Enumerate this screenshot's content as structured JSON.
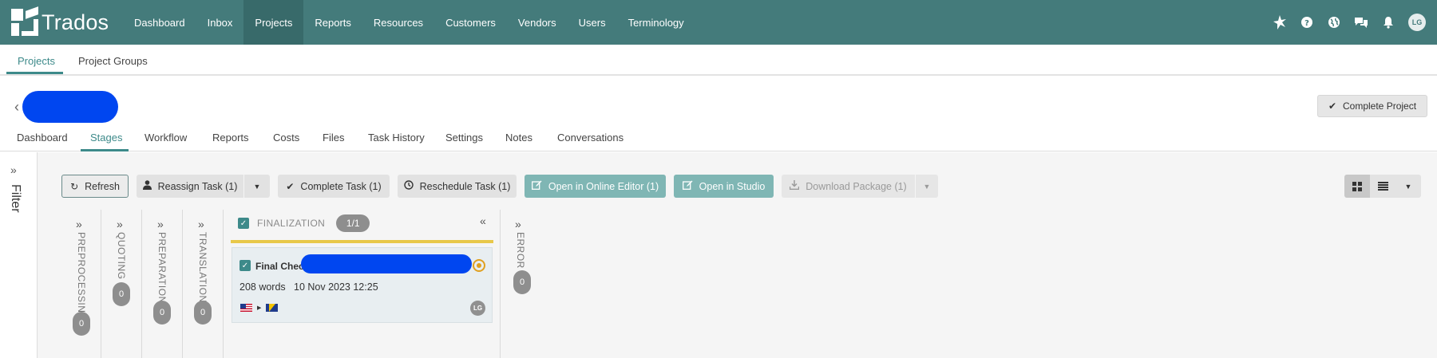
{
  "app": {
    "name": "Trados"
  },
  "nav": {
    "items": [
      {
        "label": "Dashboard"
      },
      {
        "label": "Inbox"
      },
      {
        "label": "Projects"
      },
      {
        "label": "Reports"
      },
      {
        "label": "Resources"
      },
      {
        "label": "Customers"
      },
      {
        "label": "Vendors"
      },
      {
        "label": "Users"
      },
      {
        "label": "Terminology"
      }
    ],
    "active": "Projects",
    "user_initials": "LG"
  },
  "subtabs": {
    "projects": "Projects",
    "project_groups": "Project Groups"
  },
  "project": {
    "complete_label": "Complete Project"
  },
  "project_tabs": {
    "dashboard": "Dashboard",
    "stages": "Stages",
    "workflow": "Workflow",
    "reports": "Reports",
    "costs": "Costs",
    "files": "Files",
    "task_history": "Task History",
    "settings": "Settings",
    "notes": "Notes",
    "conversations": "Conversations"
  },
  "filter": {
    "label": "Filter"
  },
  "toolbar": {
    "refresh": "Refresh",
    "reassign": "Reassign Task (1)",
    "complete": "Complete Task (1)",
    "reschedule": "Reschedule Task (1)",
    "open_online": "Open in Online Editor (1)",
    "open_studio": "Open in Studio",
    "download": "Download Package (1)"
  },
  "stages": {
    "preprocessing": {
      "name": "PREPROCESSING",
      "count": "0"
    },
    "quoting": {
      "name": "QUOTING",
      "count": "0"
    },
    "preparation": {
      "name": "PREPARATION",
      "count": "0"
    },
    "translation": {
      "name": "TRANSLATION",
      "count": "0"
    },
    "finalization": {
      "name": "FINALIZATION",
      "count": "1/1"
    },
    "error": {
      "name": "ERROR",
      "count": "0"
    }
  },
  "task": {
    "title": "Final Check",
    "words": "208 words",
    "date": "10 Nov 2023 12:25",
    "assignee_initials": "LG"
  },
  "colors": {
    "header": "#447b7b",
    "accent": "#3d8a8a",
    "finalization_bar": "#e8c84a",
    "redaction": "#0046f0"
  }
}
